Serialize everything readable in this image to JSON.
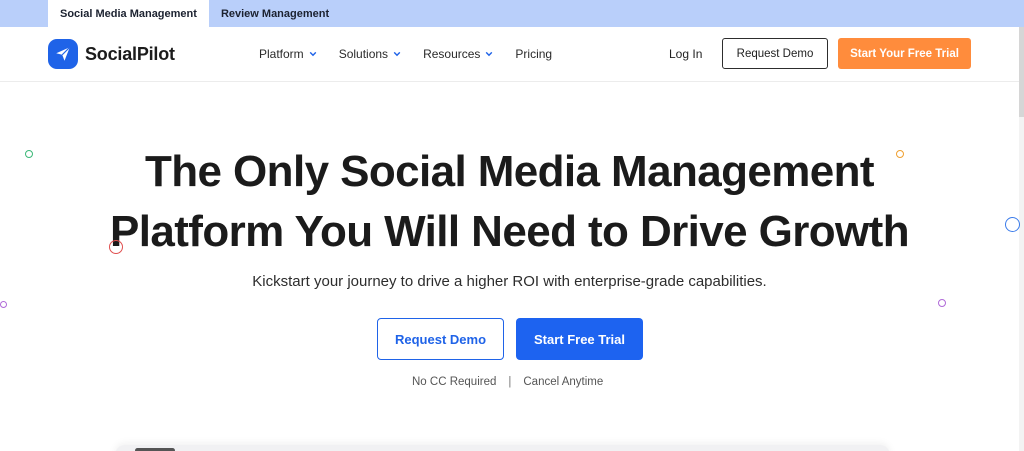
{
  "topbar": {
    "tabs": [
      {
        "label": "Social Media Management",
        "active": true
      },
      {
        "label": "Review Management",
        "active": false
      }
    ]
  },
  "nav": {
    "brand": "SocialPilot",
    "menu": [
      {
        "label": "Platform",
        "dropdown": true
      },
      {
        "label": "Solutions",
        "dropdown": true
      },
      {
        "label": "Resources",
        "dropdown": true
      },
      {
        "label": "Pricing",
        "dropdown": false
      }
    ],
    "login": "Log In",
    "request_demo": "Request Demo",
    "trial": "Start Your Free Trial"
  },
  "hero": {
    "headline_line1": "The Only Social Media Management",
    "headline_line2": "Platform You Will Need to Drive Growth",
    "subtitle": "Kickstart your journey to drive a higher ROI with enterprise-grade capabilities.",
    "primary_button": "Start Free Trial",
    "secondary_button": "Request Demo",
    "note_left": "No CC Required",
    "note_sep": "|",
    "note_right": "Cancel Anytime"
  },
  "colors": {
    "brand_blue": "#1d63f0",
    "trial_orange": "#ff8c3c",
    "topbar_bg": "#b9cffa"
  },
  "icons": {
    "logo": "paper-plane-icon",
    "dropdown": "chevron-down-icon"
  }
}
